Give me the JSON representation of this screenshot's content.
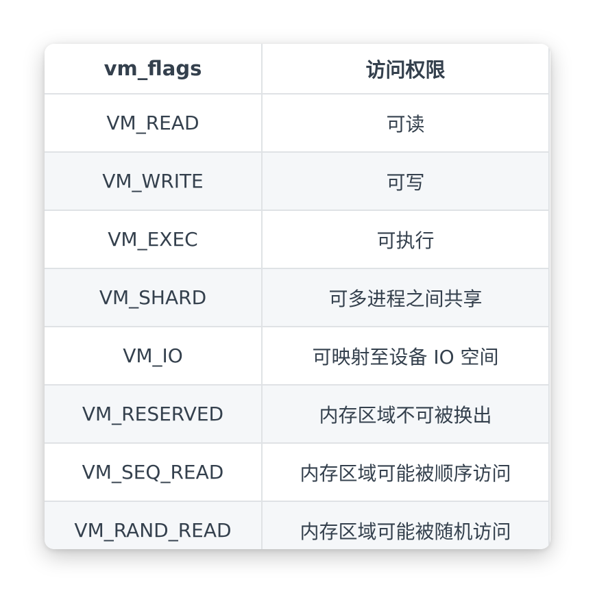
{
  "table": {
    "headers": [
      "vm_flags",
      "访问权限"
    ],
    "rows": [
      [
        "VM_READ",
        "可读"
      ],
      [
        "VM_WRITE",
        "可写"
      ],
      [
        "VM_EXEC",
        "可执行"
      ],
      [
        "VM_SHARD",
        "可多进程之间共享"
      ],
      [
        "VM_IO",
        "可映射至设备 IO 空间"
      ],
      [
        "VM_RESERVED",
        "内存区域不可被换出"
      ],
      [
        "VM_SEQ_READ",
        "内存区域可能被顺序访问"
      ],
      [
        "VM_RAND_READ",
        "内存区域可能被随机访问"
      ]
    ]
  },
  "colors": {
    "text": "#34404d",
    "border": "#dfe2e5",
    "stripe": "#f5f7f9"
  }
}
